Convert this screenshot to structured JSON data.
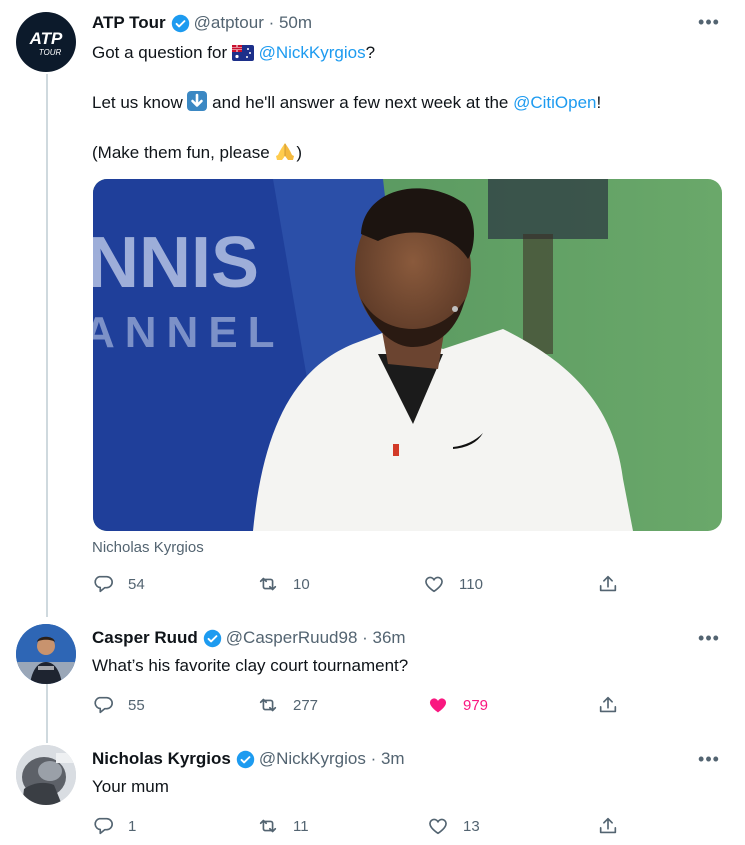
{
  "thread_colors": {
    "text": "#0f1419",
    "secondary": "#536471",
    "accent": "#1d9bf0",
    "like": "#f91880"
  },
  "tweets": [
    {
      "name": "ATP Tour",
      "handle": "@atptour · 50m",
      "avatar_logo": "ATP",
      "avatar_logo_sub": "TOUR",
      "line1_prefix": "Got a question for ",
      "line1_mention": "@NickKyrgios",
      "line1_suffix": "?",
      "line2_prefix": "Let us know ",
      "line2_middle": " and he'll answer a few next week at the ",
      "line2_mention": "@CitiOpen",
      "line2_suffix": "!",
      "line3_prefix": "(Make them fun, please ",
      "line3_suffix": ")",
      "media_bg_text_1": "NNIS",
      "media_bg_text_2": "ANNEL",
      "media_caption": "Nicholas Kyrgios",
      "replies": "54",
      "retweets": "10",
      "likes": "110"
    },
    {
      "name": "Casper Ruud",
      "handle": "@CasperRuud98 · 36m",
      "text": "What’s his favorite clay court tournament?",
      "replies": "55",
      "retweets": "277",
      "likes": "979"
    },
    {
      "name": "Nicholas Kyrgios",
      "handle": "@NickKyrgios · 3m",
      "text": "Your mum",
      "replies": "1",
      "retweets": "11",
      "likes": "13"
    }
  ],
  "icons": [
    "verified-badge-icon",
    "more-icon",
    "reply-icon",
    "retweet-icon",
    "like-icon",
    "share-icon",
    "australia-flag-icon",
    "down-arrow-icon",
    "folded-hands-icon"
  ]
}
